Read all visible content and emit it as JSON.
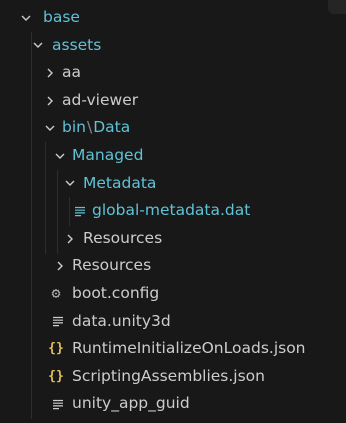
{
  "explorer": {
    "items": [
      {
        "name": "base",
        "type": "folder",
        "expanded": true
      },
      {
        "name": "assets",
        "type": "folder",
        "expanded": true
      },
      {
        "name": "aa",
        "type": "folder",
        "expanded": false
      },
      {
        "name": "ad-viewer",
        "type": "folder",
        "expanded": false
      },
      {
        "name_a": "bin",
        "sep": "\\",
        "name_b": "Data",
        "type": "folder",
        "expanded": true
      },
      {
        "name": "Managed",
        "type": "folder",
        "expanded": true
      },
      {
        "name": "Metadata",
        "type": "folder",
        "expanded": true
      },
      {
        "name": "global-metadata.dat",
        "type": "file",
        "icon": "lines-icon"
      },
      {
        "name": "Resources",
        "type": "folder",
        "expanded": false
      },
      {
        "name": "Resources",
        "type": "folder",
        "expanded": false
      },
      {
        "name": "boot.config",
        "type": "file",
        "icon": "gear-icon",
        "glyph": "⚙"
      },
      {
        "name": "data.unity3d",
        "type": "file",
        "icon": "lines-icon"
      },
      {
        "name": "RuntimeInitializeOnLoads.json",
        "type": "file",
        "icon": "json-braces-icon",
        "glyph": "{}"
      },
      {
        "name": "ScriptingAssemblies.json",
        "type": "file",
        "icon": "json-braces-icon",
        "glyph": "{}"
      },
      {
        "name": "unity_app_guid",
        "type": "file",
        "icon": "lines-icon"
      }
    ]
  },
  "colors": {
    "background": "#181818",
    "text": "#cccccc",
    "folder_open_text": "#5fc2d6",
    "json_icon": "#e2c05d",
    "gear_icon": "#b0b0b0"
  }
}
